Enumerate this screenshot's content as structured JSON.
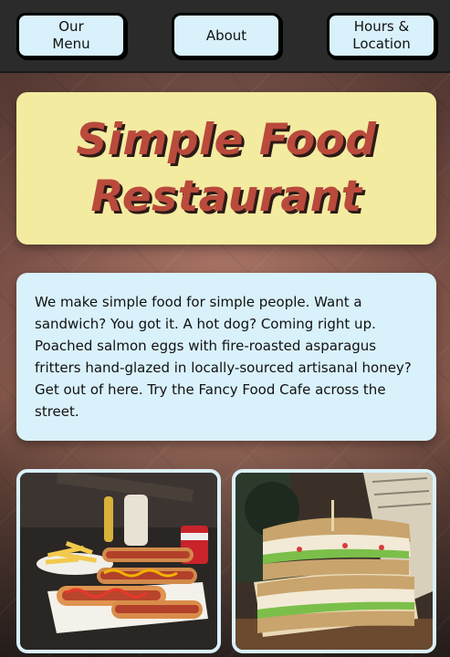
{
  "nav": {
    "menu_label": "Our Menu",
    "about_label": "About",
    "hours_label": "Hours & Location"
  },
  "hero": {
    "title": "Simple Food Restaurant"
  },
  "about": {
    "text": "We make simple food for simple people. Want a sandwich? You got it. A hot dog? Coming right up. Poached salmon eggs with fire-roasted asparagus fritters hand-glazed in locally-sourced artisanal honey? Get out of here. Try the Fancy Food Cafe across the street."
  },
  "gallery": {
    "photos": [
      "hot-dogs-and-fries",
      "sandwich"
    ]
  },
  "colors": {
    "nav_bg": "#2b2b2b",
    "button_bg": "#d9f1fb",
    "title_bg": "#f3eba0",
    "title_text": "#b94a3c",
    "text_box_bg": "#d9f1fb"
  }
}
